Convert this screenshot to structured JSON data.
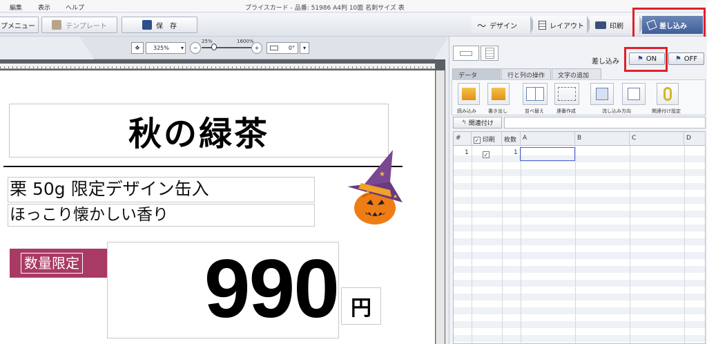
{
  "menubar": {
    "items": [
      "編集",
      "表示",
      "ヘルプ"
    ],
    "title": "プライスカード ‐ 品番: 51986 A4判 10面 名刺サイズ 表"
  },
  "toolbar": {
    "menu_label": "プメニュー",
    "template_label": "テンプレート",
    "save_label": "保　存"
  },
  "workflow": {
    "tabs": [
      {
        "label": "デザイン"
      },
      {
        "label": "レイアウト"
      },
      {
        "label": "印刷"
      },
      {
        "label": "差し込み"
      }
    ]
  },
  "zoom": {
    "value": "325%",
    "min_label": "25%",
    "max_label": "1600%",
    "rotation": "0°"
  },
  "card": {
    "headline": "秋の緑茶",
    "line1": "栗 50g 限定デザイン缶入",
    "line2": "ほっこり懐かしい香り",
    "badge": "数量限定",
    "price": "990",
    "currency": "円"
  },
  "merge": {
    "label": "差し込み",
    "on_label": "ON",
    "off_label": "OFF"
  },
  "subtabs": [
    "データ",
    "行と列の操作",
    "文字の追加"
  ],
  "ribbon": {
    "items": [
      "読み込み",
      "書き出し",
      "並べ替え",
      "連番作成",
      "流し込み方向",
      "関連付け設定"
    ]
  },
  "link_button": "関連付け",
  "grid": {
    "headers": [
      "#",
      "印刷",
      "枚数",
      "A",
      "B",
      "C",
      "D"
    ],
    "rows": [
      {
        "num": "1",
        "print": "✓",
        "count": "1"
      }
    ]
  }
}
